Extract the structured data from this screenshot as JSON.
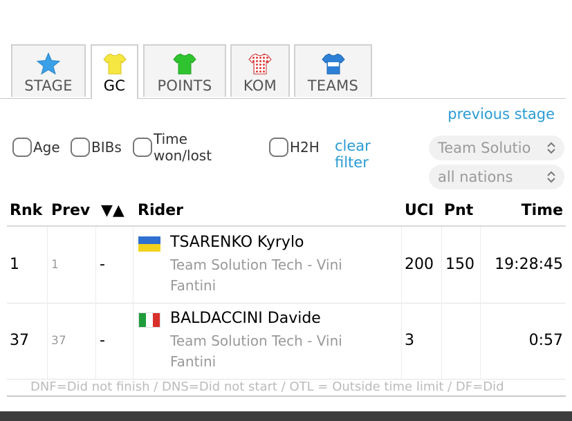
{
  "tabs": [
    {
      "label": "STAGE",
      "icon": "star-icon",
      "color": "#3aa0e8",
      "active": false
    },
    {
      "label": "GC",
      "icon": "yellow-jersey-icon",
      "color": "#f5e642",
      "active": true
    },
    {
      "label": "POINTS",
      "icon": "green-jersey-icon",
      "color": "#2fc42f",
      "active": false
    },
    {
      "label": "KOM",
      "icon": "polka-dot-jersey-icon",
      "color": "#e03a3a",
      "active": false
    },
    {
      "label": "TEAMS",
      "icon": "blue-jersey-icon",
      "color": "#2e7fd6",
      "active": false
    }
  ],
  "links": {
    "previous_stage": "previous stage",
    "clear_filter": "clear filter"
  },
  "filters": [
    "Age",
    "BIBs",
    "Time won/lost",
    "H2H"
  ],
  "selects": {
    "team": "Team Solutio",
    "nation": "all nations"
  },
  "table": {
    "headers": {
      "rank": "Rnk",
      "prev": "Prev",
      "delta": "▼▲",
      "rider": "Rider",
      "uci": "UCI",
      "pnt": "Pnt",
      "time": "Time"
    },
    "rows": [
      {
        "rank": "1",
        "prev": "1",
        "delta": "-",
        "flag": "ukraine-flag",
        "rider": "TSARENKO Kyrylo",
        "team": "Team Solution Tech - Vini Fantini",
        "uci": "200",
        "pnt": "150",
        "time": "19:28:45"
      },
      {
        "rank": "37",
        "prev": "37",
        "delta": "-",
        "flag": "italy-flag",
        "rider": "BALDACCINI Davide",
        "team": "Team Solution Tech - Vini Fantini",
        "uci": "3",
        "pnt": "",
        "time": "0:57"
      }
    ]
  },
  "footnote": "DNF=Did not finish / DNS=Did not start / OTL = Outside time limit / DF=Did"
}
